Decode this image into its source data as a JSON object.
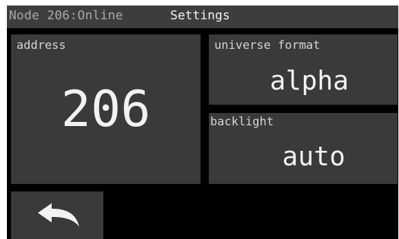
{
  "colors": {
    "header_background": "#3d3d3d",
    "screen_background": "#000000",
    "tile_background": "#3a3a3a",
    "status_text": "#a9a9a9",
    "text": "#f2f2f2"
  },
  "header": {
    "node_status": "Node 206:Online",
    "title": "Settings"
  },
  "tiles": {
    "address": {
      "label": "address",
      "value": "206"
    },
    "universe_format": {
      "label": "universe format",
      "value": "alpha"
    },
    "backlight": {
      "label": "backlight",
      "value": "auto"
    }
  },
  "back_button": {
    "icon": "back-arrow-icon"
  }
}
